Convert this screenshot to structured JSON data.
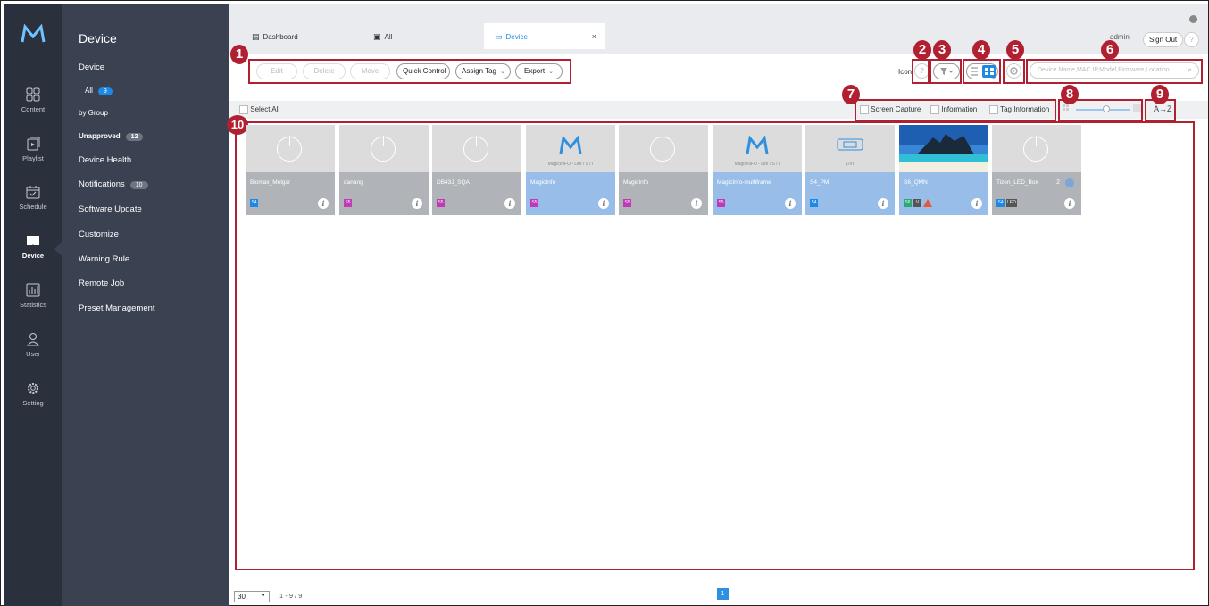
{
  "sidebar": {
    "items": [
      {
        "label": "Content",
        "icon": "content-icon"
      },
      {
        "label": "Playlist",
        "icon": "playlist-icon"
      },
      {
        "label": "Schedule",
        "icon": "schedule-icon"
      },
      {
        "label": "Device",
        "icon": "device-icon",
        "active": true
      },
      {
        "label": "Statistics",
        "icon": "statistics-icon"
      },
      {
        "label": "User",
        "icon": "user-icon"
      },
      {
        "label": "Setting",
        "icon": "gear-icon"
      }
    ]
  },
  "subnav": {
    "title": "Device",
    "back_icon": "←",
    "device_label": "Device",
    "all_label": "All",
    "all_count": "9",
    "by_group_label": "by Group",
    "unapproved_label": "Unapproved",
    "unapproved_count": "12",
    "device_health": "Device Health",
    "notifications": "Notifications",
    "notifications_count": "10",
    "software_update": "Software Update",
    "customize": "Customize",
    "warning_rule": "Warning Rule",
    "remote_job": "Remote Job",
    "preset_management": "Preset Management"
  },
  "tabs": [
    {
      "label": "Dashboard",
      "icon": "▤"
    },
    {
      "label": "All",
      "icon": "▣"
    },
    {
      "label": "Device",
      "icon": "▭"
    }
  ],
  "tab_close": "×",
  "header": {
    "user": "admin",
    "sign_out": "Sign Out",
    "help": "?"
  },
  "toolbar": {
    "edit": "Edit",
    "delete": "Delete",
    "move": "Move",
    "quick_control": "Quick Control",
    "assign_tag": "Assign Tag",
    "export": "Export",
    "caret": "⌄",
    "icon_label": "Icon",
    "help": "?",
    "search_placeholder": "Device Name,MAC IP,Model,Firmware,Location",
    "search_icon": "⌕"
  },
  "select_row": {
    "select_all": "Select All",
    "screen_capture": "Screen Capture",
    "information": "Information",
    "tag_information": "Tag Information",
    "sort": "A→Z"
  },
  "annotations": [
    "1",
    "2",
    "3",
    "4",
    "5",
    "6",
    "7",
    "8",
    "9",
    "10"
  ],
  "devices": [
    {
      "name": "Biomax_Melgar",
      "badge": "S4",
      "badge_color": "#1e88e5",
      "thumb": "power",
      "highlight": false
    },
    {
      "name": "danang",
      "badge": "S5",
      "badge_color": "#c03ab8",
      "thumb": "power",
      "highlight": false
    },
    {
      "name": "DB43J_SQA",
      "badge": "S5",
      "badge_color": "#c03ab8",
      "thumb": "power",
      "highlight": false
    },
    {
      "name": "MagicInfo",
      "badge": "S5",
      "badge_color": "#c03ab8",
      "thumb": "magicinfo",
      "thumb_text": "MagicINFO - Lite / S / I",
      "highlight": true
    },
    {
      "name": "MagicInfo",
      "badge": "S5",
      "badge_color": "#c03ab8",
      "thumb": "power",
      "highlight": false
    },
    {
      "name": "MagicInfo-multiframe",
      "badge": "S5",
      "badge_color": "#c03ab8",
      "thumb": "magicinfo",
      "thumb_text": "MagicINFO - Lite / S / I",
      "highlight": true
    },
    {
      "name": "S4_PM",
      "badge": "S4",
      "badge_color": "#1e88e5",
      "thumb": "dvi",
      "thumb_text": "DVI",
      "highlight": true
    },
    {
      "name": "S6_QMN",
      "badge": "S6",
      "badge_color": "#2aa876",
      "thumb": "photo",
      "extra_badge": "V",
      "highlight": true
    },
    {
      "name": "Tizen_LED_Box",
      "badge": "S4",
      "badge_color": "#1e88e5",
      "thumb": "power",
      "extra_badge": "LED",
      "count": "2",
      "highlight": false
    }
  ],
  "footer": {
    "page_size": "30",
    "range": "1 - 9 / 9",
    "page": "1"
  }
}
